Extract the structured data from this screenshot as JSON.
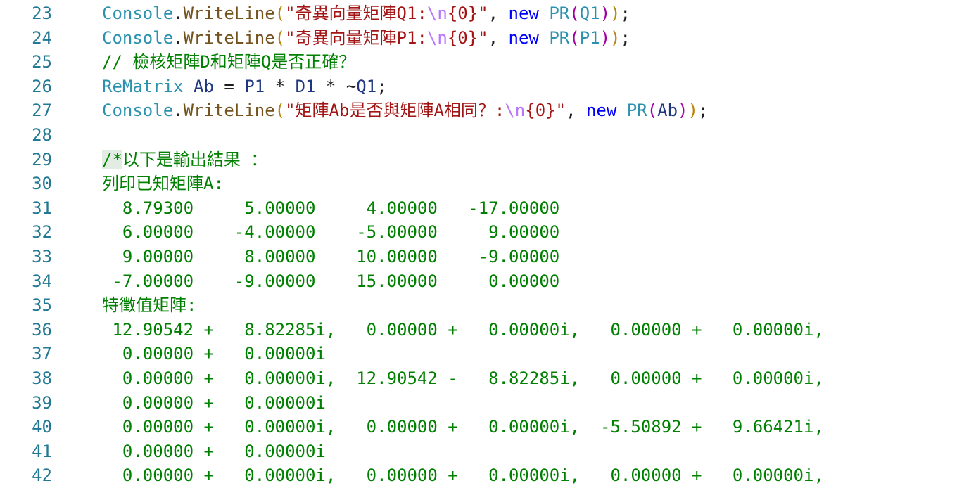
{
  "editor": {
    "lines": [
      {
        "num": "23",
        "tokens": [
          {
            "t": "Console",
            "c": "ident"
          },
          {
            "t": ".",
            "c": "plain"
          },
          {
            "t": "WriteLine",
            "c": "method"
          },
          {
            "t": "(",
            "c": "b1"
          },
          {
            "t": "\"奇異向量矩陣Q1:",
            "c": "string"
          },
          {
            "t": "\\n",
            "c": "escape"
          },
          {
            "t": "{0}\"",
            "c": "string"
          },
          {
            "t": ", ",
            "c": "plain"
          },
          {
            "t": "new",
            "c": "keyword"
          },
          {
            "t": " ",
            "c": "plain"
          },
          {
            "t": "PR",
            "c": "ident"
          },
          {
            "t": "(",
            "c": "b2"
          },
          {
            "t": "Q1",
            "c": "ident"
          },
          {
            "t": ")",
            "c": "b2"
          },
          {
            "t": ")",
            "c": "b1"
          },
          {
            "t": ";",
            "c": "plain"
          }
        ]
      },
      {
        "num": "24",
        "tokens": [
          {
            "t": "Console",
            "c": "ident"
          },
          {
            "t": ".",
            "c": "plain"
          },
          {
            "t": "WriteLine",
            "c": "method"
          },
          {
            "t": "(",
            "c": "b1"
          },
          {
            "t": "\"奇異向量矩陣P1:",
            "c": "string"
          },
          {
            "t": "\\n",
            "c": "escape"
          },
          {
            "t": "{0}\"",
            "c": "string"
          },
          {
            "t": ", ",
            "c": "plain"
          },
          {
            "t": "new",
            "c": "keyword"
          },
          {
            "t": " ",
            "c": "plain"
          },
          {
            "t": "PR",
            "c": "ident"
          },
          {
            "t": "(",
            "c": "b2"
          },
          {
            "t": "P1",
            "c": "ident"
          },
          {
            "t": ")",
            "c": "b2"
          },
          {
            "t": ")",
            "c": "b1"
          },
          {
            "t": ";",
            "c": "plain"
          }
        ]
      },
      {
        "num": "25",
        "tokens": [
          {
            "t": "// 檢核矩陣D和矩陣Q是否正確？",
            "c": "comment"
          }
        ]
      },
      {
        "num": "26",
        "tokens": [
          {
            "t": "ReMatrix",
            "c": "ident"
          },
          {
            "t": " ",
            "c": "plain"
          },
          {
            "t": "Ab",
            "c": "var"
          },
          {
            "t": " = ",
            "c": "plain"
          },
          {
            "t": "P1",
            "c": "var"
          },
          {
            "t": " * ",
            "c": "plain"
          },
          {
            "t": "D1",
            "c": "var"
          },
          {
            "t": " * ~",
            "c": "plain"
          },
          {
            "t": "Q1",
            "c": "var"
          },
          {
            "t": ";",
            "c": "plain"
          }
        ]
      },
      {
        "num": "27",
        "tokens": [
          {
            "t": "Console",
            "c": "ident"
          },
          {
            "t": ".",
            "c": "plain"
          },
          {
            "t": "WriteLine",
            "c": "method"
          },
          {
            "t": "(",
            "c": "b1"
          },
          {
            "t": "\"矩陣Ab是否與矩陣A相同？:",
            "c": "string"
          },
          {
            "t": "\\n",
            "c": "escape"
          },
          {
            "t": "{0}\"",
            "c": "string"
          },
          {
            "t": ", ",
            "c": "plain"
          },
          {
            "t": "new",
            "c": "keyword"
          },
          {
            "t": " ",
            "c": "plain"
          },
          {
            "t": "PR",
            "c": "ident"
          },
          {
            "t": "(",
            "c": "b2"
          },
          {
            "t": "Ab",
            "c": "var"
          },
          {
            "t": ")",
            "c": "b2"
          },
          {
            "t": ")",
            "c": "b1"
          },
          {
            "t": ";",
            "c": "plain"
          }
        ]
      },
      {
        "num": "28",
        "tokens": []
      },
      {
        "num": "29",
        "tokens": [
          {
            "t": "/*",
            "c": "comment",
            "hl": true
          },
          {
            "t": "以下是輸出結果 ：",
            "c": "comment"
          }
        ]
      },
      {
        "num": "30",
        "tokens": [
          {
            "t": "列印已知矩陣A:",
            "c": "comment"
          }
        ]
      },
      {
        "num": "31",
        "tokens": [
          {
            "t": "  8.79300     5.00000     4.00000   -17.00000",
            "c": "comment"
          }
        ]
      },
      {
        "num": "32",
        "tokens": [
          {
            "t": "  6.00000    -4.00000    -5.00000     9.00000",
            "c": "comment"
          }
        ]
      },
      {
        "num": "33",
        "tokens": [
          {
            "t": "  9.00000     8.00000    10.00000    -9.00000",
            "c": "comment"
          }
        ]
      },
      {
        "num": "34",
        "tokens": [
          {
            "t": " -7.00000    -9.00000    15.00000     0.00000",
            "c": "comment"
          }
        ]
      },
      {
        "num": "35",
        "tokens": [
          {
            "t": "特徵值矩陣:",
            "c": "comment"
          }
        ]
      },
      {
        "num": "36",
        "tokens": [
          {
            "t": " 12.90542 +   8.82285i,   0.00000 +   0.00000i,   0.00000 +   0.00000i,",
            "c": "comment"
          }
        ]
      },
      {
        "num": "37",
        "tokens": [
          {
            "t": "  0.00000 +   0.00000i",
            "c": "comment"
          }
        ]
      },
      {
        "num": "38",
        "tokens": [
          {
            "t": "  0.00000 +   0.00000i,  12.90542 -   8.82285i,   0.00000 +   0.00000i,",
            "c": "comment"
          }
        ]
      },
      {
        "num": "39",
        "tokens": [
          {
            "t": "  0.00000 +   0.00000i",
            "c": "comment"
          }
        ]
      },
      {
        "num": "40",
        "tokens": [
          {
            "t": "  0.00000 +   0.00000i,   0.00000 +   0.00000i,  -5.50892 +   9.66421i,",
            "c": "comment"
          }
        ]
      },
      {
        "num": "41",
        "tokens": [
          {
            "t": "  0.00000 +   0.00000i",
            "c": "comment"
          }
        ]
      },
      {
        "num": "42",
        "tokens": [
          {
            "t": "  0.00000 +   0.00000i,   0.00000 +   0.00000i,   0.00000 +   0.00000i,",
            "c": "comment"
          }
        ]
      }
    ]
  }
}
